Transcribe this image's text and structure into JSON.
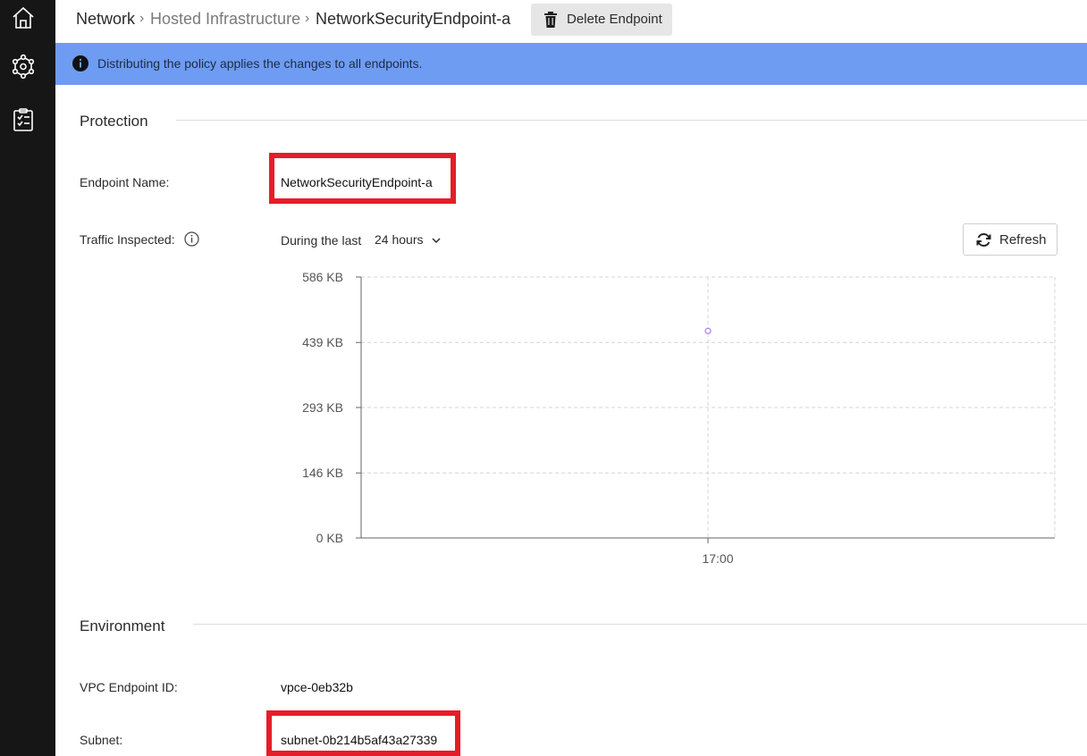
{
  "sidebar": {
    "items": [
      {
        "icon": "home-icon"
      },
      {
        "icon": "network-nodes-icon"
      },
      {
        "icon": "clipboard-checklist-icon"
      }
    ]
  },
  "breadcrumb": {
    "root": "Network",
    "middle": "Hosted Infrastructure",
    "current": "NetworkSecurityEndpoint-a",
    "separator": "›"
  },
  "toolbar": {
    "delete_label": "Delete Endpoint",
    "delete_icon": "trash-icon"
  },
  "banner": {
    "icon": "info-icon",
    "text": "Distributing the policy applies the changes to all endpoints.",
    "color": "#6e9cf2"
  },
  "protection": {
    "title": "Protection",
    "endpoint_name_label": "Endpoint Name:",
    "endpoint_name_value": "NetworkSecurityEndpoint-a",
    "traffic_label": "Traffic Inspected:",
    "range_prefix": "During the last",
    "range_value": "24 hours",
    "refresh_label": "Refresh"
  },
  "environment": {
    "title": "Environment",
    "vpc_label": "VPC Endpoint ID:",
    "vpc_value": "vpce-0eb32b",
    "subnet_label": "Subnet:",
    "subnet_value": "subnet-0b214b5af43a27339"
  },
  "highlight_color": "#e51d2a",
  "chart_data": {
    "type": "scatter",
    "ytick_labels": [
      "0 KB",
      "146 KB",
      "293 KB",
      "439 KB",
      "586 KB"
    ],
    "yticks": [
      0,
      146,
      293,
      439,
      586
    ],
    "ylim": [
      0,
      586
    ],
    "xtick_labels": [
      "17:00"
    ],
    "grid": true,
    "series": [
      {
        "x": [
          "17:00"
        ],
        "values": [
          465
        ],
        "color": "#b07ee8"
      }
    ]
  }
}
